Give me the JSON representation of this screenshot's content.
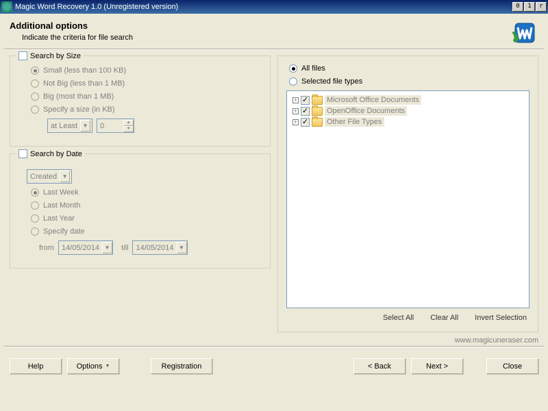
{
  "window": {
    "title": "Magic Word Recovery 1.0 (Unregistered version)"
  },
  "header": {
    "title": "Additional options",
    "subtitle": "Indicate the criteria for file search"
  },
  "size": {
    "legend": "Search by Size",
    "small": "Small (less than 100 KB)",
    "notbig": "Not Big (less than 1 MB)",
    "big": "Big (most than 1 MB)",
    "specify": "Specify a size (in KB)",
    "mode": "at Least",
    "value": "0"
  },
  "date": {
    "legend": "Search by Date",
    "field": "Created",
    "lastweek": "Last Week",
    "lastmonth": "Last Month",
    "lastyear": "Last Year",
    "specify": "Specify date",
    "from_label": "from",
    "till_label": "till",
    "from_value": "14/05/2014",
    "till_value": "14/05/2014"
  },
  "filter": {
    "all": "All files",
    "selected": "Selected file types",
    "items": [
      "Microsoft Office Documents",
      "OpenOffice Documents",
      "Other File Types"
    ],
    "select_all": "Select All",
    "clear_all": "Clear All",
    "invert": "Invert Selection"
  },
  "footer": {
    "url": "www.magicuneraser.com",
    "help": "Help",
    "options": "Options",
    "registration": "Registration",
    "back": "< Back",
    "next": "Next >",
    "close": "Close"
  }
}
